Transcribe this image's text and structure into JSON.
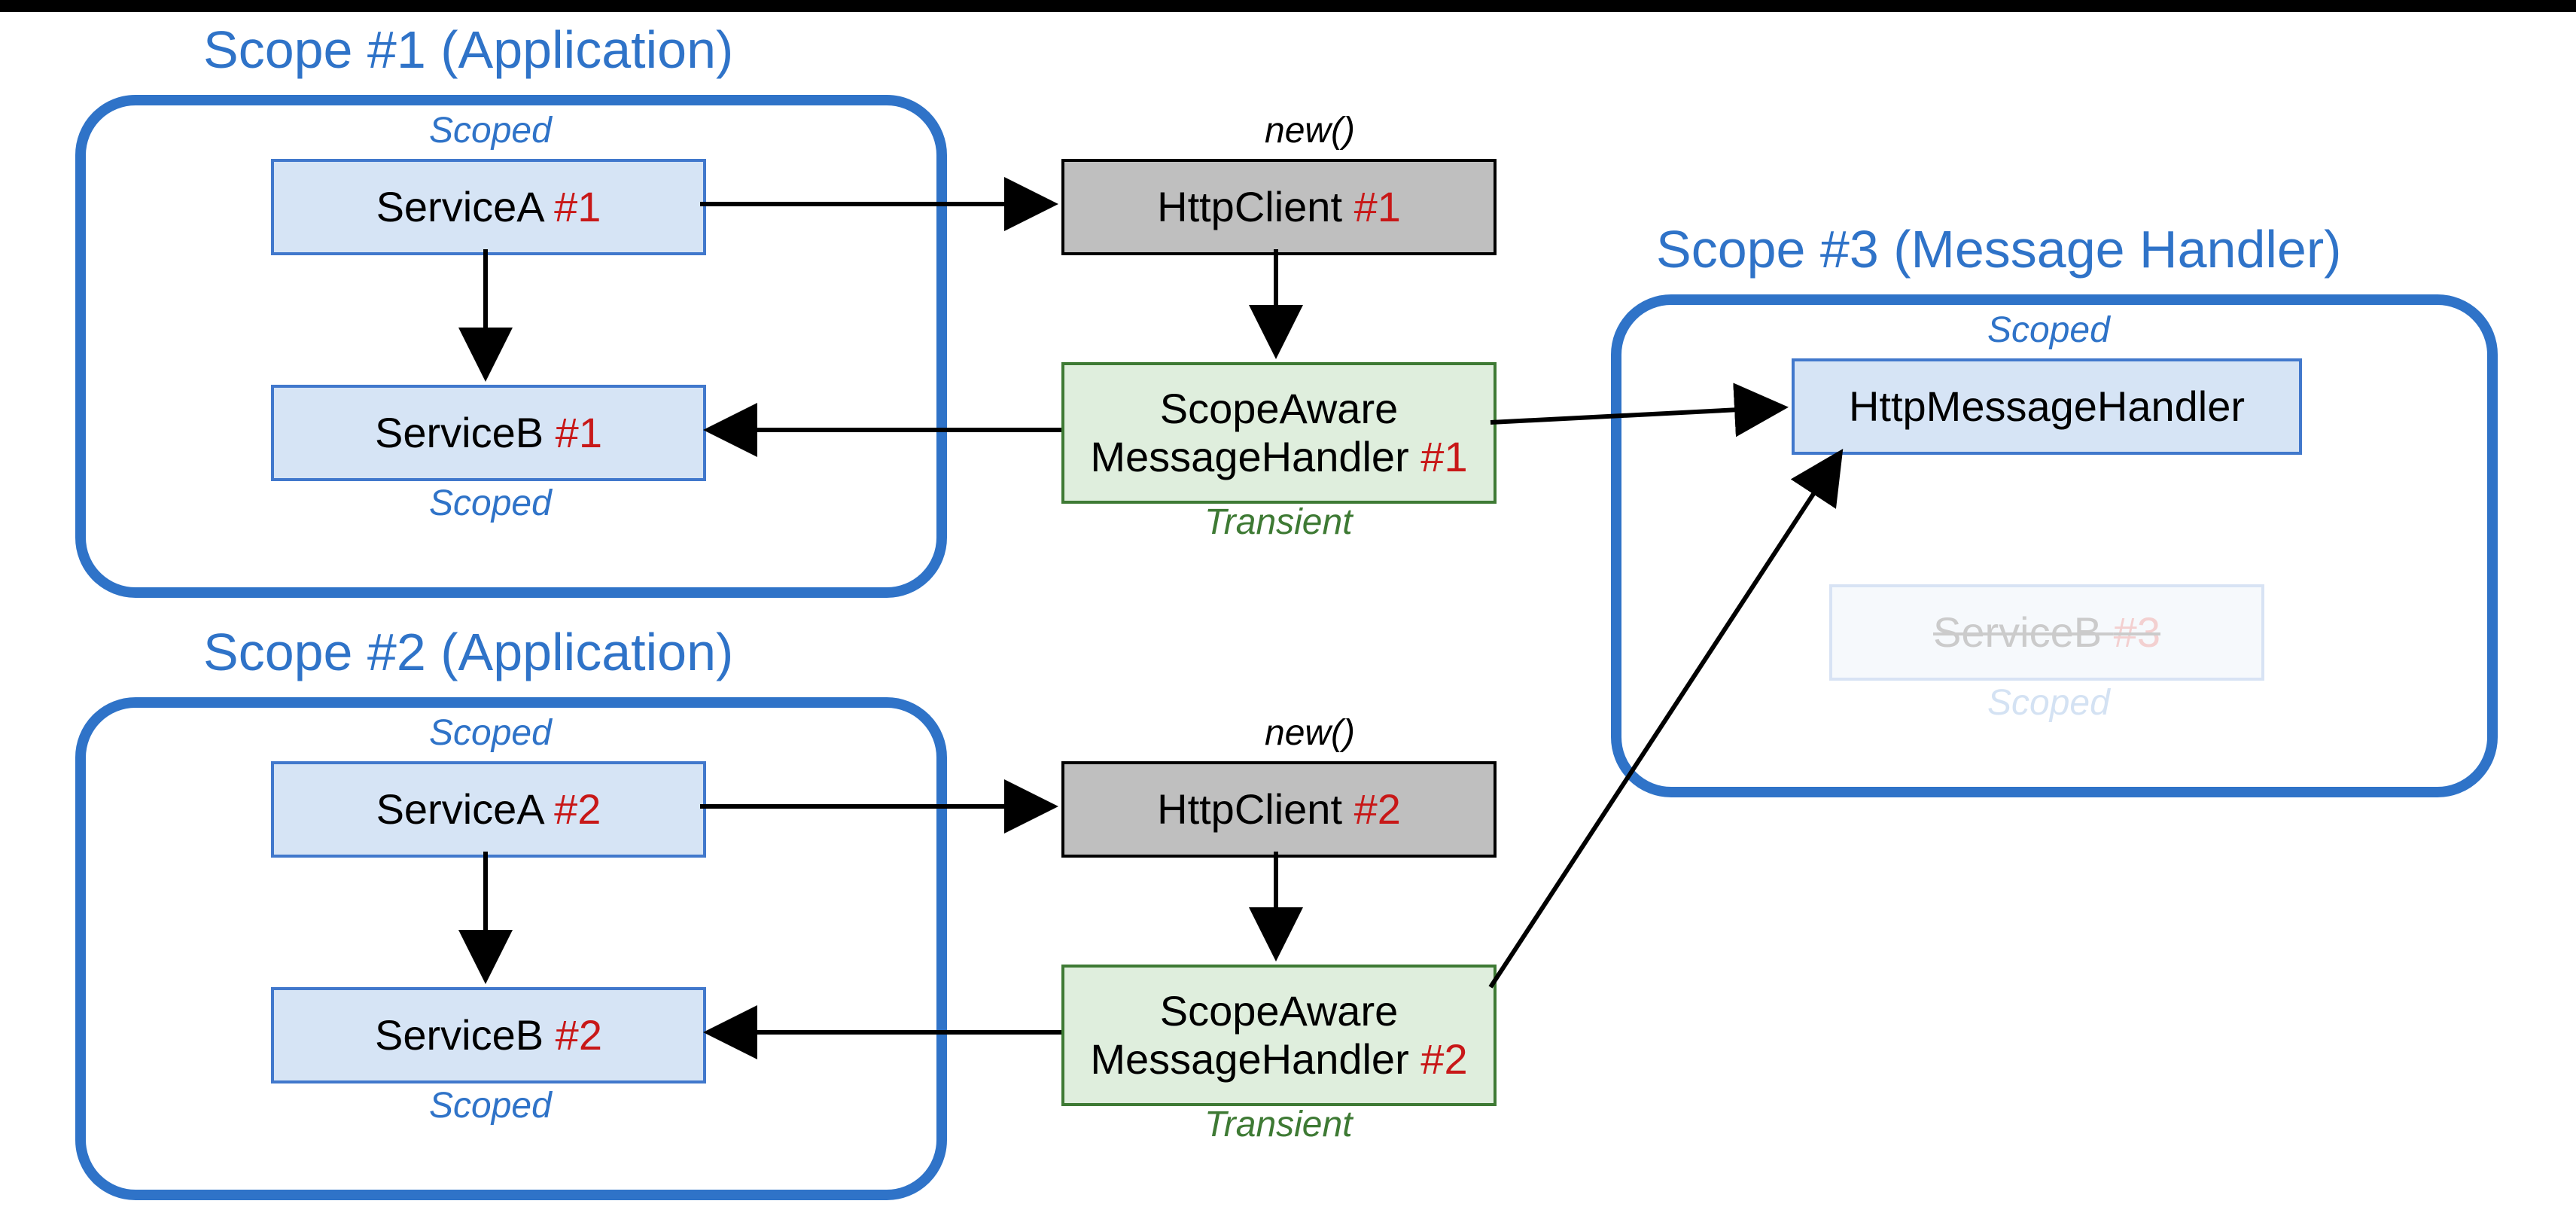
{
  "scopes": {
    "s1": {
      "title": "Scope #1 (Application)"
    },
    "s2": {
      "title": "Scope #2 (Application)"
    },
    "s3": {
      "title": "Scope #3 (Message Handler)"
    }
  },
  "lifetimes": {
    "scoped": "Scoped",
    "transient": "Transient",
    "new": "new()"
  },
  "boxes": {
    "serviceA1": {
      "name": "ServiceA ",
      "num": "#1"
    },
    "serviceB1": {
      "name": "ServiceB ",
      "num": "#1"
    },
    "serviceA2": {
      "name": "ServiceA ",
      "num": "#2"
    },
    "serviceB2": {
      "name": "ServiceB ",
      "num": "#2"
    },
    "httpClient1": {
      "name": "HttpClient ",
      "num": "#1"
    },
    "httpClient2": {
      "name": "HttpClient ",
      "num": "#2"
    },
    "handler1": {
      "l1": "ScopeAware",
      "l2name": "MessageHandler ",
      "l2num": "#1"
    },
    "handler2": {
      "l1": "ScopeAware",
      "l2name": "MessageHandler ",
      "l2num": "#2"
    },
    "httpMsgHandler": {
      "name": "HttpMessageHandler"
    },
    "serviceB3": {
      "name": "ServiceB ",
      "num": "#3"
    }
  }
}
